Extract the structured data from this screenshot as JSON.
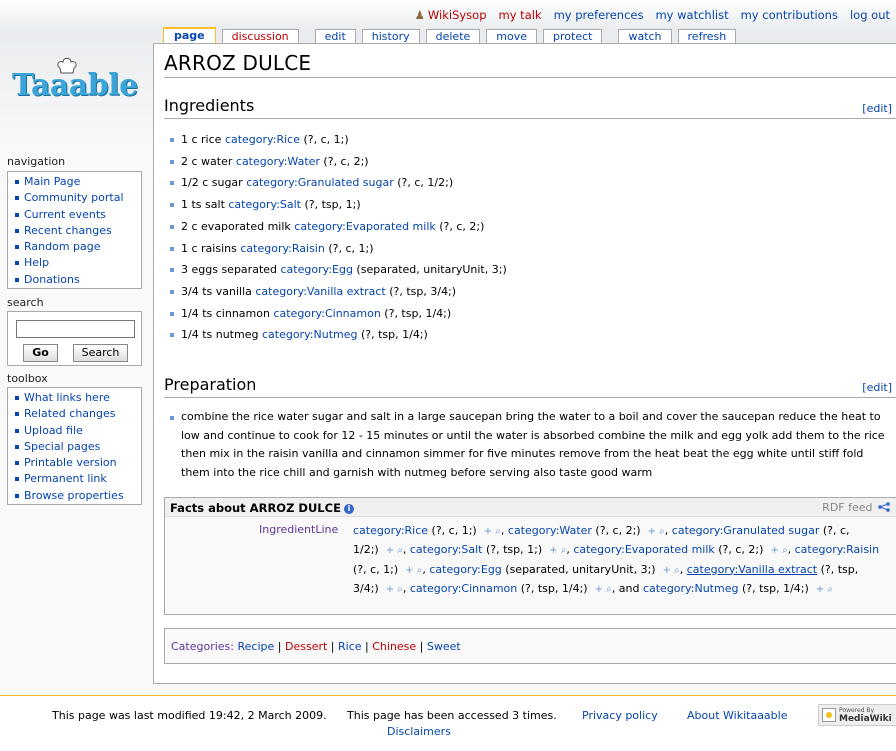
{
  "personal_tools": {
    "user": "WikiSysop",
    "my_talk": "my talk",
    "my_preferences": "my preferences",
    "my_watchlist": "my watchlist",
    "my_contributions": "my contributions",
    "log_out": "log out"
  },
  "tabs": {
    "page": "page",
    "discussion": "discussion",
    "edit": "edit",
    "history": "history",
    "delete": "delete",
    "move": "move",
    "protect": "protect",
    "watch": "watch",
    "refresh": "refresh"
  },
  "logo": {
    "text": "Taaable"
  },
  "sidebar": {
    "navigation": {
      "heading": "navigation",
      "items": [
        {
          "label": "Main Page"
        },
        {
          "label": "Community portal"
        },
        {
          "label": "Current events"
        },
        {
          "label": "Recent changes"
        },
        {
          "label": "Random page"
        },
        {
          "label": "Help"
        },
        {
          "label": "Donations"
        }
      ]
    },
    "search": {
      "heading": "search",
      "value": "",
      "go_label": "Go",
      "search_label": "Search"
    },
    "toolbox": {
      "heading": "toolbox",
      "items": [
        {
          "label": "What links here"
        },
        {
          "label": "Related changes"
        },
        {
          "label": "Upload file"
        },
        {
          "label": "Special pages"
        },
        {
          "label": "Printable version"
        },
        {
          "label": "Permanent link"
        },
        {
          "label": "Browse properties"
        }
      ]
    }
  },
  "page": {
    "title": "ARROZ DULCE",
    "ingredients_heading": "Ingredients",
    "edit_label": "[edit]",
    "ingredients": [
      {
        "text": "1 c rice ",
        "link": "category:Rice",
        "rest": " (?, c, 1;)"
      },
      {
        "text": "2 c water ",
        "link": "category:Water",
        "rest": " (?, c, 2;)"
      },
      {
        "text": "1/2 c sugar ",
        "link": "category:Granulated sugar",
        "rest": " (?, c, 1/2;)"
      },
      {
        "text": "1 ts salt ",
        "link": "category:Salt",
        "rest": " (?, tsp, 1;)"
      },
      {
        "text": "2 c evaporated milk ",
        "link": "category:Evaporated milk",
        "rest": " (?, c, 2;)"
      },
      {
        "text": "1 c raisins ",
        "link": "category:Raisin",
        "rest": " (?, c, 1;)"
      },
      {
        "text": "3 eggs separated ",
        "link": "category:Egg",
        "rest": " (separated, unitaryUnit, 3;)"
      },
      {
        "text": "3/4 ts vanilla ",
        "link": "category:Vanilla extract",
        "rest": " (?, tsp, 3/4;)"
      },
      {
        "text": "1/4 ts cinnamon ",
        "link": "category:Cinnamon",
        "rest": " (?, tsp, 1/4;)"
      },
      {
        "text": "1/4 ts nutmeg ",
        "link": "category:Nutmeg",
        "rest": " (?, tsp, 1/4;)"
      }
    ],
    "preparation_heading": "Preparation",
    "preparation_text": "combine the rice water sugar and salt in a large saucepan bring the water to a boil and cover the saucepan reduce the heat to low and continue to cook for 12 - 15 minutes or until the water is absorbed combine the milk and egg yolk add them to the rice then mix in the raisin vanilla and cinnamon simmer for five minutes remove from the heat beat the egg white until stiff fold them into the rice chill and garnish with nutmeg before serving also taste good warm"
  },
  "factbox": {
    "title": "Facts about ARROZ DULCE",
    "rdf_feed": "RDF feed",
    "property": "IngredientLine",
    "values": [
      {
        "link": "category:Rice",
        "rest": " (?, c, 1;)"
      },
      {
        "link": "category:Water",
        "rest": " (?, c, 2;)"
      },
      {
        "link": "category:Granulated sugar",
        "rest": " (?, c, 1/2;)"
      },
      {
        "link": "category:Salt",
        "rest": " (?, tsp, 1;)"
      },
      {
        "link": "category:Evaporated milk",
        "rest": " (?, c, 2;)"
      },
      {
        "link": "category:Raisin",
        "rest": " (?, c, 1;)"
      },
      {
        "link": "category:Egg",
        "rest": " (separated, unitaryUnit, 3;)"
      },
      {
        "link": "category:Vanilla extract",
        "rest": " (?, tsp, 3/4;)"
      },
      {
        "link": "category:Cinnamon",
        "rest": " (?, tsp, 1/4;)"
      },
      {
        "link": "category:Nutmeg",
        "rest": " (?, tsp, 1/4;)"
      }
    ],
    "and_label": "and"
  },
  "categories": {
    "label": "Categories",
    "items": [
      {
        "label": "Recipe",
        "status": "existing"
      },
      {
        "label": "Dessert",
        "status": "missing"
      },
      {
        "label": "Rice",
        "status": "existing"
      },
      {
        "label": "Chinese",
        "status": "missing"
      },
      {
        "label": "Sweet",
        "status": "existing"
      }
    ]
  },
  "footer": {
    "last_modified": "This page was last modified 19:42, 2 March 2009.",
    "accessed": "This page has been accessed 3 times.",
    "privacy": "Privacy policy",
    "about": "About Wikitaaable",
    "disclaimers": "Disclaimers",
    "powered_by": "Powered By",
    "mediawiki": "MediaWiki"
  },
  "colors": {
    "link": "#0645ad",
    "missing_link": "#ba0000",
    "tab_selected_border": "#fabd23",
    "logo": "#3ba4d8"
  }
}
